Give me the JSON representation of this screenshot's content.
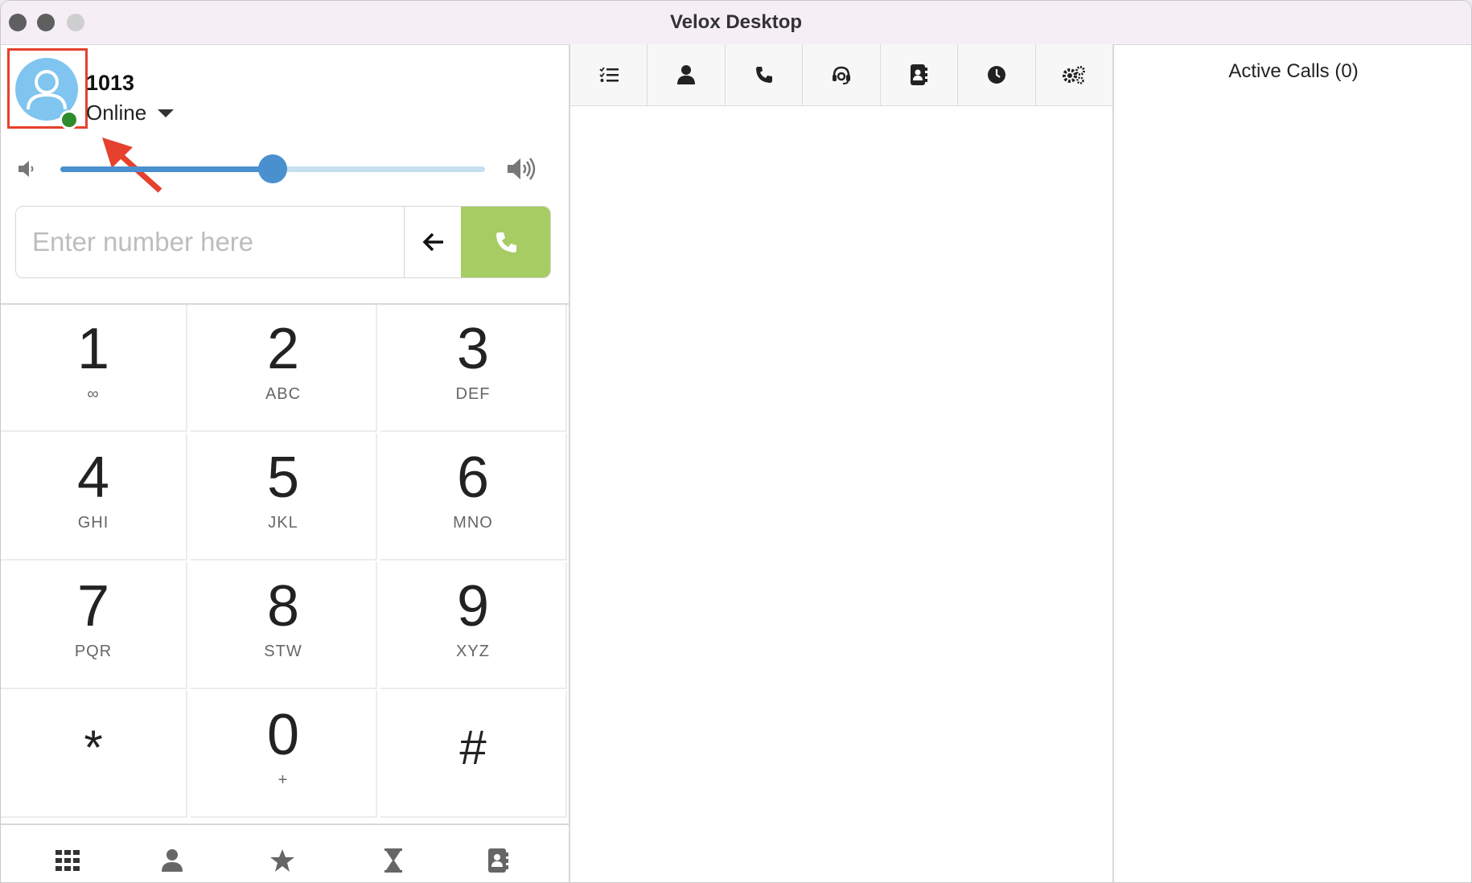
{
  "window": {
    "title": "Velox Desktop"
  },
  "user": {
    "extension": "1013",
    "status": "Online",
    "status_color": "#2e8b2e"
  },
  "volume": {
    "level_percent": 50
  },
  "dialer": {
    "placeholder": "Enter number here",
    "call_color": "#a6cc63"
  },
  "keypad": [
    {
      "digit": "1",
      "letters": "∞"
    },
    {
      "digit": "2",
      "letters": "ABC"
    },
    {
      "digit": "3",
      "letters": "DEF"
    },
    {
      "digit": "4",
      "letters": "GHI"
    },
    {
      "digit": "5",
      "letters": "JKL"
    },
    {
      "digit": "6",
      "letters": "MNO"
    },
    {
      "digit": "7",
      "letters": "PQR"
    },
    {
      "digit": "8",
      "letters": "STW"
    },
    {
      "digit": "9",
      "letters": "XYZ"
    },
    {
      "digit": "*",
      "letters": ""
    },
    {
      "digit": "0",
      "letters": "+"
    },
    {
      "digit": "#",
      "letters": ""
    }
  ],
  "toolbar_icons": [
    "list-check-icon",
    "user-icon",
    "phone-icon",
    "headset-icon",
    "address-book-icon",
    "clock-icon",
    "gears-icon"
  ],
  "bottom_tab_icons": [
    "keypad-icon",
    "user-icon",
    "star-icon",
    "hourglass-icon",
    "address-book-icon"
  ],
  "active_calls": {
    "title": "Active Calls (0)"
  },
  "annotation": {
    "highlight_color": "#e5412d"
  }
}
